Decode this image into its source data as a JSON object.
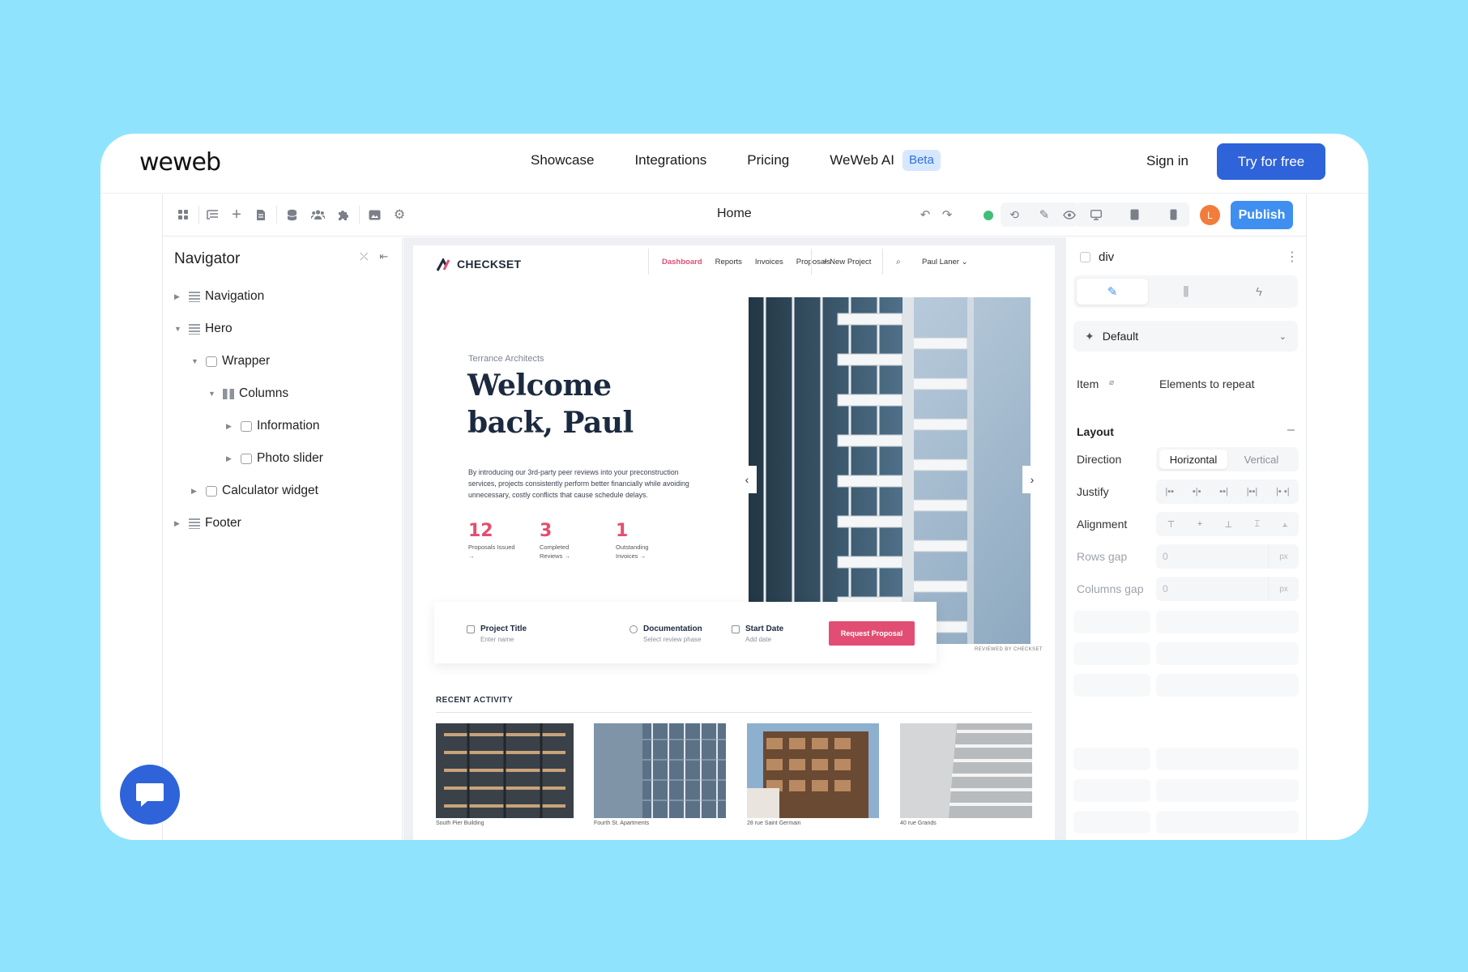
{
  "site": {
    "logo": "weweb",
    "nav": [
      "Showcase",
      "Integrations",
      "Pricing",
      "WeWeb AI"
    ],
    "beta_badge": "Beta",
    "sign_in": "Sign in",
    "cta": "Try for free"
  },
  "toolbar": {
    "page_name": "Home",
    "avatar_initial": "L",
    "publish": "Publish"
  },
  "navigator": {
    "title": "Navigator",
    "tree": [
      {
        "label": "Navigation",
        "icon": "rows-icon",
        "depth": 0,
        "expanded": false
      },
      {
        "label": "Hero",
        "icon": "rows-icon",
        "depth": 0,
        "expanded": true
      },
      {
        "label": "Wrapper",
        "icon": "box-icon",
        "depth": 1,
        "expanded": true
      },
      {
        "label": "Columns",
        "icon": "columns-icon",
        "depth": 2,
        "expanded": true
      },
      {
        "label": "Information",
        "icon": "box-icon",
        "depth": 3,
        "expanded": false
      },
      {
        "label": "Photo slider",
        "icon": "box-icon",
        "depth": 3,
        "expanded": false
      },
      {
        "label": "Calculator widget",
        "icon": "box-icon",
        "depth": 1,
        "expanded": false
      },
      {
        "label": "Footer",
        "icon": "rows-icon",
        "depth": 0,
        "expanded": false
      }
    ]
  },
  "preview": {
    "brand": "CHECKSET",
    "nav": [
      "Dashboard",
      "Reports",
      "Invoices",
      "Proposals"
    ],
    "new_project": "+ New Project",
    "user": "Paul Laner ⌄",
    "company": "Terrance Architects",
    "welcome": "Welcome back, Paul",
    "intro": "By introducing our 3rd-party peer reviews into your preconstruction services, projects consistently perform better financially while avoiding unnecessary, costly conflicts that cause schedule delays.",
    "stats": [
      {
        "value": "12",
        "label": "Proposals Issued →"
      },
      {
        "value": "3",
        "label": "Completed Reviews →"
      },
      {
        "value": "1",
        "label": "Outstanding Invoices →"
      }
    ],
    "form": {
      "project_title": "Project Title",
      "project_placeholder": "Enter name",
      "documentation": "Documentation",
      "documentation_sub": "Select review phase",
      "start_date": "Start Date",
      "start_date_sub": "Add date",
      "button": "Request Proposal"
    },
    "reviewed_by": "REVIEWED BY CHECKSET",
    "recent_title": "RECENT ACTIVITY",
    "recent": [
      "South Pier Building",
      "Fourth St. Apartments",
      "28 rue Saint Germain",
      "40 rue Grands"
    ]
  },
  "properties": {
    "element": "div",
    "state": "Default",
    "item_label": "Item",
    "item_value": "Elements to repeat",
    "layout_title": "Layout",
    "direction_label": "Direction",
    "direction_options": [
      "Horizontal",
      "Vertical"
    ],
    "justify_label": "Justify",
    "alignment_label": "Alignment",
    "rows_gap_label": "Rows gap",
    "rows_gap_value": "0",
    "columns_gap_label": "Columns gap",
    "columns_gap_value": "0",
    "unit": "px"
  },
  "colors": {
    "brand_blue": "#2e63d9",
    "publish_blue": "#3f8ff0",
    "checkset_pink": "#e24e73",
    "background": "#8fe3fd"
  }
}
